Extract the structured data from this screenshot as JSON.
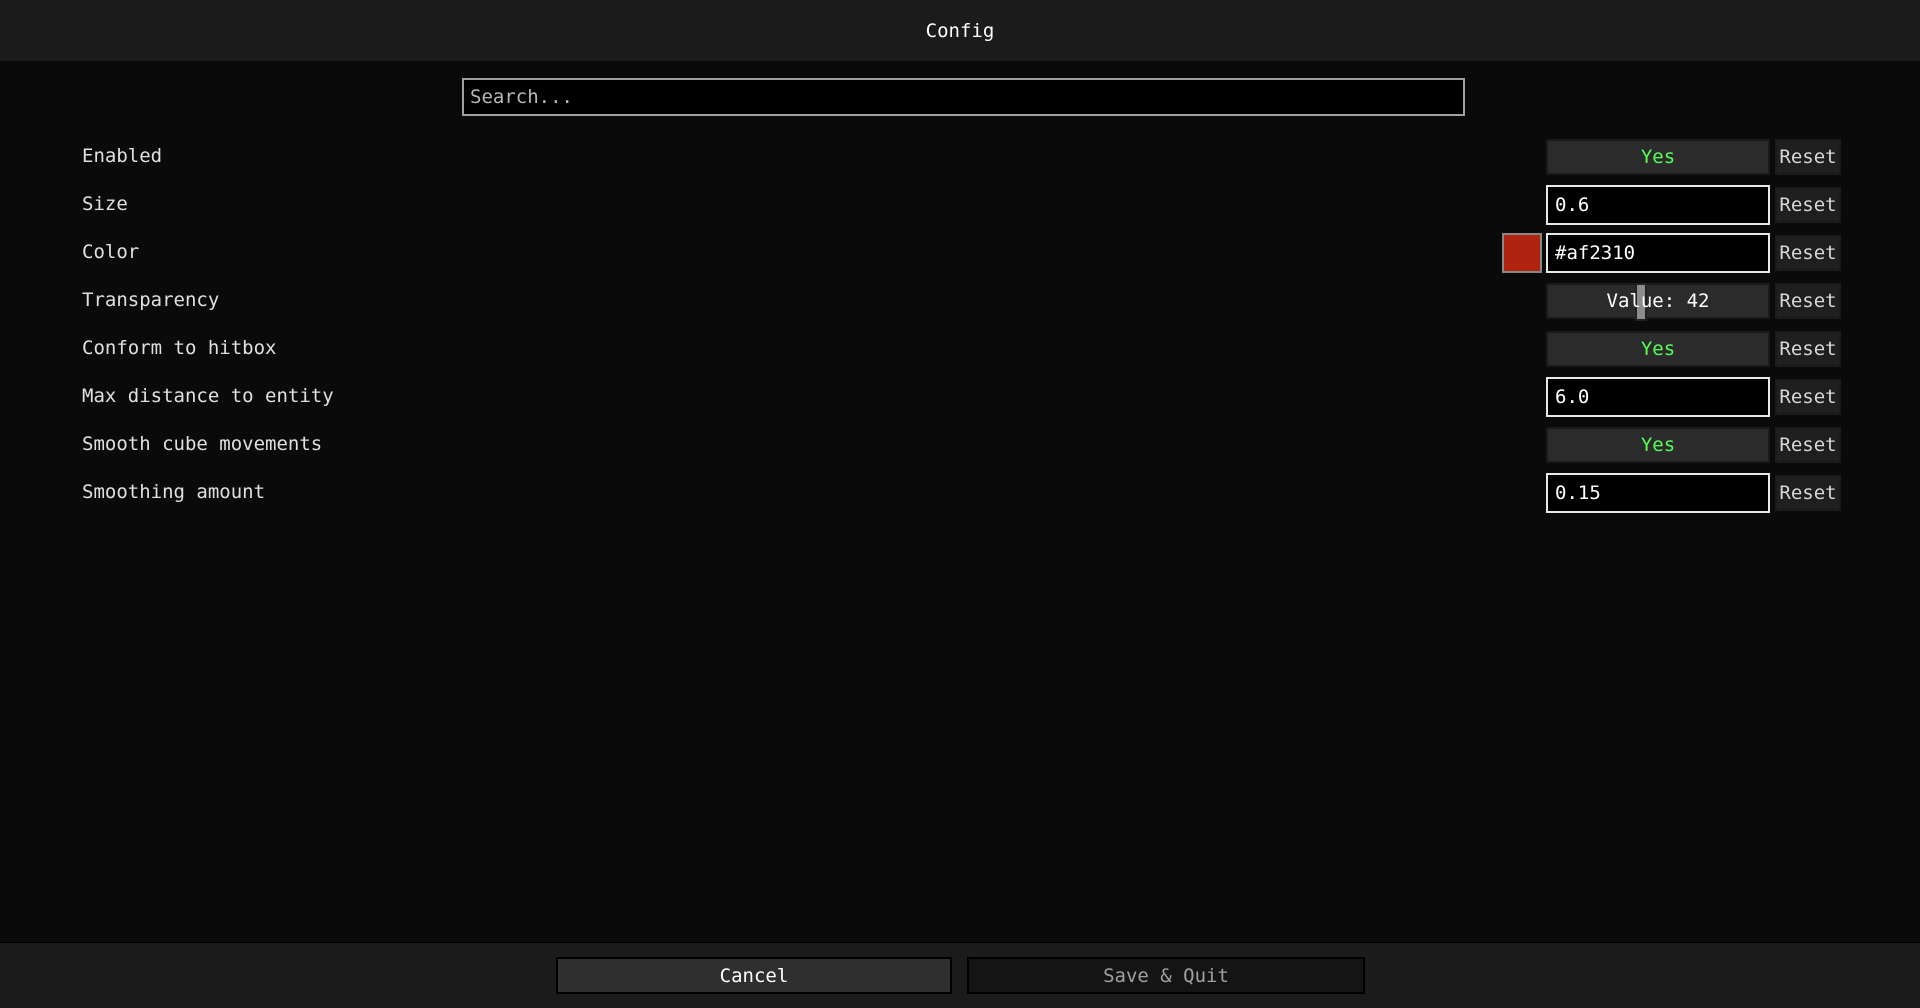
{
  "header": {
    "title": "Config"
  },
  "search": {
    "placeholder": "Search..."
  },
  "options": [
    {
      "label": "Enabled",
      "control": "toggle",
      "value": "Yes"
    },
    {
      "label": "Size",
      "control": "text",
      "value": "0.6"
    },
    {
      "label": "Color",
      "control": "color",
      "value": "#af2310"
    },
    {
      "label": "Transparency",
      "control": "slider",
      "value": "Value: 42",
      "level_percent": 42
    },
    {
      "label": "Conform to hitbox",
      "control": "toggle",
      "value": "Yes"
    },
    {
      "label": "Max distance to entity",
      "control": "text",
      "value": "6.0"
    },
    {
      "label": "Smooth cube movements",
      "control": "toggle",
      "value": "Yes"
    },
    {
      "label": "Smoothing amount",
      "control": "text",
      "value": "0.15"
    }
  ],
  "reset_label": "Reset",
  "footer": {
    "cancel_label": "Cancel",
    "save_label": "Save & Quit"
  },
  "colors": {
    "toggle_on": "#55ff55",
    "swatch": "#af2310"
  }
}
